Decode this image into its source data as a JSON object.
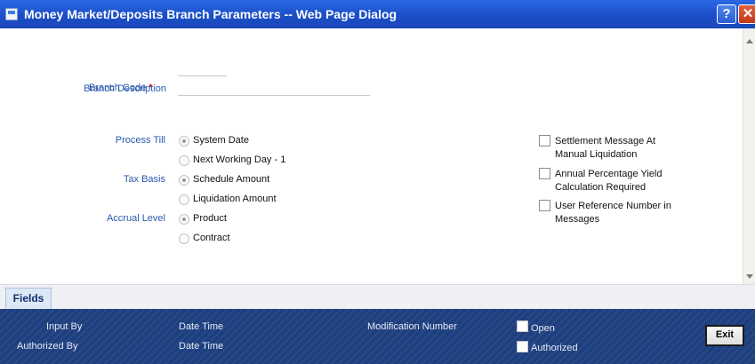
{
  "window": {
    "title": "Money Market/Deposits Branch Parameters -- Web Page Dialog",
    "help_label": "?",
    "close_label": "✕"
  },
  "form": {
    "branch_code_label": "Branch Code",
    "required_mark": "*",
    "branch_description_label": "Branch Description",
    "process_till": {
      "label": "Process Till",
      "options": [
        "System Date",
        "Next Working Day - 1"
      ],
      "selected": "System Date"
    },
    "tax_basis": {
      "label": "Tax Basis",
      "options": [
        "Schedule Amount",
        "Liquidation Amount"
      ],
      "selected": "Schedule Amount"
    },
    "accrual_level": {
      "label": "Accrual Level",
      "options": [
        "Product",
        "Contract"
      ],
      "selected": "Product"
    },
    "checkboxes": [
      {
        "line1": "Settlement Message At",
        "line2": "Manual Liquidation",
        "checked": false
      },
      {
        "line1": "Annual Percentage Yield",
        "line2": "Calculation Required",
        "checked": false
      },
      {
        "line1": "User Reference Number in",
        "line2": "Messages",
        "checked": false
      }
    ]
  },
  "tabs": [
    {
      "label": "Fields"
    }
  ],
  "footer": {
    "input_by": "Input By",
    "authorized_by": "Authorized By",
    "date_time_1": "Date Time",
    "date_time_2": "Date Time",
    "modification_number": "Modification Number",
    "open_label": "Open",
    "authorized_label": "Authorized",
    "exit_label": "Exit"
  },
  "colors": {
    "titlebar": "#1b4fc7",
    "label_blue": "#2a5aab",
    "footer_bg": "#1e3f7f",
    "required": "#d40000"
  }
}
